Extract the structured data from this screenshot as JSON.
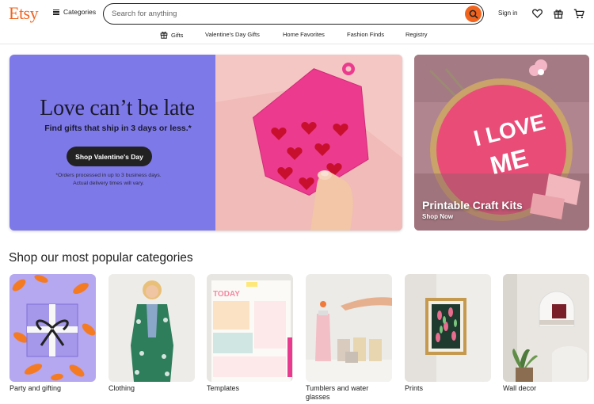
{
  "header": {
    "logo": "Etsy",
    "categories_label": "Categories",
    "search_placeholder": "Search for anything",
    "signin_label": "Sign in"
  },
  "subnav": {
    "items": [
      "Gifts",
      "Valentine's Day Gifts",
      "Home Favorites",
      "Fashion Finds",
      "Registry"
    ]
  },
  "hero": {
    "title": "Love can’t be late",
    "subtitle": "Find gifts that ship in 3 days or less.*",
    "button": "Shop Valentine's Day",
    "note": "*Orders processed in up to 3 business days. Actual delivery times will vary.",
    "background_color": "#7e79e8"
  },
  "side_card": {
    "title": "Printable Craft Kits",
    "link": "Shop Now"
  },
  "section": {
    "title": "Shop our most popular categories",
    "categories": [
      {
        "label": "Party and gifting"
      },
      {
        "label": "Clothing"
      },
      {
        "label": "Templates"
      },
      {
        "label": "Tumblers and water glasses"
      },
      {
        "label": "Prints"
      },
      {
        "label": "Wall decor"
      }
    ]
  },
  "colors": {
    "brand": "#f1641e",
    "text": "#222222",
    "button_dark": "#222222"
  },
  "icons": [
    "hamburger-icon",
    "search-icon",
    "heart-icon",
    "gift-icon",
    "cart-icon"
  ]
}
